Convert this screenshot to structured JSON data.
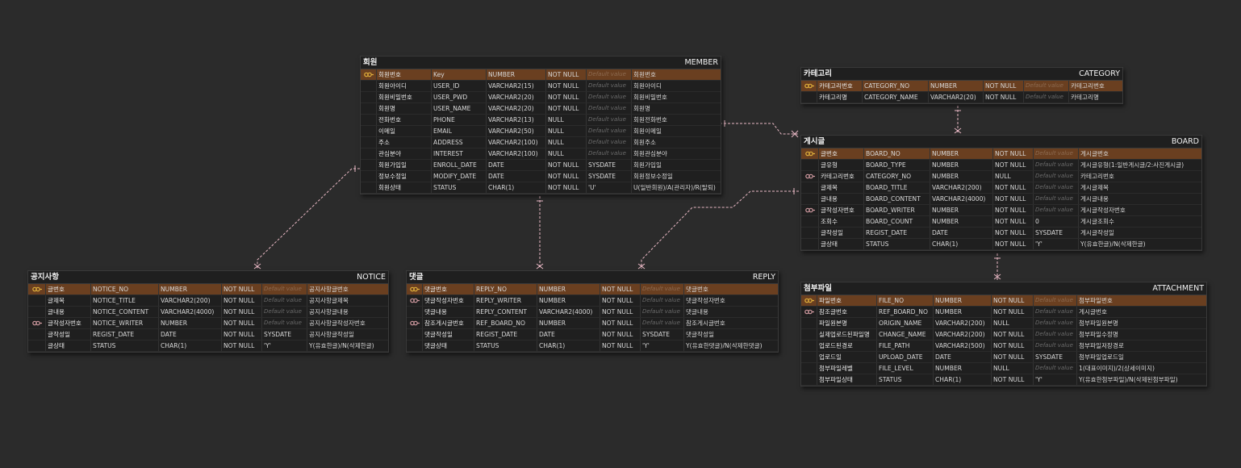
{
  "colors": {
    "background": "#2b2b2b",
    "entity_bg": "#1f1f1f",
    "pk_row": "#6a3f20",
    "pk_key": "#e0b03c",
    "fk_key": "#d09aa0",
    "link": "#e8b8c4"
  },
  "entities": [
    {
      "id": "member",
      "logical": "회원",
      "physical": "MEMBER",
      "columns": [
        {
          "key": "pk",
          "logical": "회원번호",
          "physical": "Key",
          "type": "NUMBER",
          "null": "NOT NULL",
          "default": "",
          "comment": "회원번호"
        },
        {
          "key": "",
          "logical": "회원아이디",
          "physical": "USER_ID",
          "type": "VARCHAR2(15)",
          "null": "NOT NULL",
          "default": "",
          "comment": "회원아이디"
        },
        {
          "key": "",
          "logical": "회원비밀번호",
          "physical": "USER_PWD",
          "type": "VARCHAR2(20)",
          "null": "NOT NULL",
          "default": "",
          "comment": "회원비밀번호"
        },
        {
          "key": "",
          "logical": "회원명",
          "physical": "USER_NAME",
          "type": "VARCHAR2(20)",
          "null": "NOT NULL",
          "default": "",
          "comment": "회원명"
        },
        {
          "key": "",
          "logical": "전화번호",
          "physical": "PHONE",
          "type": "VARCHAR2(13)",
          "null": "NULL",
          "default": "",
          "comment": "회원전화번호"
        },
        {
          "key": "",
          "logical": "이메일",
          "physical": "EMAIL",
          "type": "VARCHAR2(50)",
          "null": "NULL",
          "default": "",
          "comment": "회원이메일"
        },
        {
          "key": "",
          "logical": "주소",
          "physical": "ADDRESS",
          "type": "VARCHAR2(100)",
          "null": "NULL",
          "default": "",
          "comment": "회원주소"
        },
        {
          "key": "",
          "logical": "관심분야",
          "physical": "INTEREST",
          "type": "VARCHAR2(100)",
          "null": "NULL",
          "default": "",
          "comment": "회원관심분야"
        },
        {
          "key": "",
          "logical": "회원가입일",
          "physical": "ENROLL_DATE",
          "type": "DATE",
          "null": "NOT NULL",
          "default": "SYSDATE",
          "comment": "회원가입일"
        },
        {
          "key": "",
          "logical": "정보수정일",
          "physical": "MODIFY_DATE",
          "type": "DATE",
          "null": "NOT NULL",
          "default": "SYSDATE",
          "comment": "회원정보수정일"
        },
        {
          "key": "",
          "logical": "회원상태",
          "physical": "STATUS",
          "type": "CHAR(1)",
          "null": "NOT NULL",
          "default": "'U'",
          "comment": "U(일반회원)/A(관리자)/R(탈퇴)"
        }
      ]
    },
    {
      "id": "category",
      "logical": "카테고리",
      "physical": "CATEGORY",
      "columns": [
        {
          "key": "pk",
          "logical": "카테고리번호",
          "physical": "CATEGORY_NO",
          "type": "NUMBER",
          "null": "NOT NULL",
          "default": "",
          "comment": "카테고리번호"
        },
        {
          "key": "",
          "logical": "카테고리명",
          "physical": "CATEGORY_NAME",
          "type": "VARCHAR2(20)",
          "null": "NOT NULL",
          "default": "",
          "comment": "카테고리명"
        }
      ]
    },
    {
      "id": "board",
      "logical": "게시글",
      "physical": "BOARD",
      "columns": [
        {
          "key": "pk",
          "logical": "글번호",
          "physical": "BOARD_NO",
          "type": "NUMBER",
          "null": "NOT NULL",
          "default": "",
          "comment": "게시글번호"
        },
        {
          "key": "",
          "logical": "글유형",
          "physical": "BOARD_TYPE",
          "type": "NUMBER",
          "null": "NOT NULL",
          "default": "",
          "comment": "게시글유형(1:일반게시글/2:사진게시글)"
        },
        {
          "key": "fk",
          "logical": "카테고리번호",
          "physical": "CATEGORY_NO",
          "type": "NUMBER",
          "null": "NULL",
          "default": "",
          "comment": "카테고리번호"
        },
        {
          "key": "",
          "logical": "글제목",
          "physical": "BOARD_TITLE",
          "type": "VARCHAR2(200)",
          "null": "NOT NULL",
          "default": "",
          "comment": "게시글제목"
        },
        {
          "key": "",
          "logical": "글내용",
          "physical": "BOARD_CONTENT",
          "type": "VARCHAR2(4000)",
          "null": "NOT NULL",
          "default": "",
          "comment": "게시글내용"
        },
        {
          "key": "fk",
          "logical": "글작성자번호",
          "physical": "BOARD_WRITER",
          "type": "NUMBER",
          "null": "NOT NULL",
          "default": "",
          "comment": "게시글작성자번호"
        },
        {
          "key": "",
          "logical": "조회수",
          "physical": "BOARD_COUNT",
          "type": "NUMBER",
          "null": "NOT NULL",
          "default": "0",
          "comment": "게시글조회수"
        },
        {
          "key": "",
          "logical": "글작성일",
          "physical": "REGIST_DATE",
          "type": "DATE",
          "null": "NOT NULL",
          "default": "SYSDATE",
          "comment": "게시글작성일"
        },
        {
          "key": "",
          "logical": "글상태",
          "physical": "STATUS",
          "type": "CHAR(1)",
          "null": "NOT NULL",
          "default": "'Y'",
          "comment": "Y(유효한글)/N(삭제한글)"
        }
      ]
    },
    {
      "id": "notice",
      "logical": "공지사항",
      "physical": "NOTICE",
      "columns": [
        {
          "key": "pk",
          "logical": "글번호",
          "physical": "NOTICE_NO",
          "type": "NUMBER",
          "null": "NOT NULL",
          "default": "",
          "comment": "공지사항글번호"
        },
        {
          "key": "",
          "logical": "글제목",
          "physical": "NOTICE_TITLE",
          "type": "VARCHAR2(200)",
          "null": "NOT NULL",
          "default": "",
          "comment": "공지사항글제목"
        },
        {
          "key": "",
          "logical": "글내용",
          "physical": "NOTICE_CONTENT",
          "type": "VARCHAR2(4000)",
          "null": "NOT NULL",
          "default": "",
          "comment": "공지사항글내용"
        },
        {
          "key": "fk",
          "logical": "글작성자번호",
          "physical": "NOTICE_WRITER",
          "type": "NUMBER",
          "null": "NOT NULL",
          "default": "",
          "comment": "공지사항글작성자번호"
        },
        {
          "key": "",
          "logical": "글작성일",
          "physical": "REGIST_DATE",
          "type": "DATE",
          "null": "NOT NULL",
          "default": "SYSDATE",
          "comment": "공지사항글작성일"
        },
        {
          "key": "",
          "logical": "글상태",
          "physical": "STATUS",
          "type": "CHAR(1)",
          "null": "NOT NULL",
          "default": "'Y'",
          "comment": "Y(유효한글)/N(삭제한글)"
        }
      ]
    },
    {
      "id": "reply",
      "logical": "댓글",
      "physical": "REPLY",
      "columns": [
        {
          "key": "pk",
          "logical": "댓글번호",
          "physical": "REPLY_NO",
          "type": "NUMBER",
          "null": "NOT NULL",
          "default": "",
          "comment": "댓글번호"
        },
        {
          "key": "fk",
          "logical": "댓글작성자번호",
          "physical": "REPLY_WRITER",
          "type": "NUMBER",
          "null": "NOT NULL",
          "default": "",
          "comment": "댓글작성자번호"
        },
        {
          "key": "",
          "logical": "댓글내용",
          "physical": "REPLY_CONTENT",
          "type": "VARCHAR2(4000)",
          "null": "NOT NULL",
          "default": "",
          "comment": "댓글내용"
        },
        {
          "key": "fk",
          "logical": "참조게시글번호",
          "physical": "REF_BOARD_NO",
          "type": "NUMBER",
          "null": "NOT NULL",
          "default": "",
          "comment": "참조게시글번호"
        },
        {
          "key": "",
          "logical": "댓글작성일",
          "physical": "REGIST_DATE",
          "type": "DATE",
          "null": "NOT NULL",
          "default": "SYSDATE",
          "comment": "댓글작성일"
        },
        {
          "key": "",
          "logical": "댓글상태",
          "physical": "STATUS",
          "type": "CHAR(1)",
          "null": "NOT NULL",
          "default": "'Y'",
          "comment": "Y(유효한댓글)/N(삭제한댓글)"
        }
      ]
    },
    {
      "id": "attachment",
      "logical": "첨부파일",
      "physical": "ATTACHMENT",
      "columns": [
        {
          "key": "pk",
          "logical": "파일번호",
          "physical": "FILE_NO",
          "type": "NUMBER",
          "null": "NOT NULL",
          "default": "",
          "comment": "첨부파일번호"
        },
        {
          "key": "fk",
          "logical": "참조글번호",
          "physical": "REF_BOARD_NO",
          "type": "NUMBER",
          "null": "NOT NULL",
          "default": "",
          "comment": "게시글번호"
        },
        {
          "key": "",
          "logical": "파일원본명",
          "physical": "ORIGIN_NAME",
          "type": "VARCHAR2(200)",
          "null": "NULL",
          "default": "",
          "comment": "첨부파일원본명"
        },
        {
          "key": "",
          "logical": "실제업로드된파일명",
          "physical": "CHANGE_NAME",
          "type": "VARCHAR2(200)",
          "null": "NOT NULL",
          "default": "",
          "comment": "첨부파일수정명"
        },
        {
          "key": "",
          "logical": "업로드된경로",
          "physical": "FILE_PATH",
          "type": "VARCHAR2(500)",
          "null": "NOT NULL",
          "default": "",
          "comment": "첨부파일저장경로"
        },
        {
          "key": "",
          "logical": "업로드일",
          "physical": "UPLOAD_DATE",
          "type": "DATE",
          "null": "NOT NULL",
          "default": "SYSDATE",
          "comment": "첨부파일업로드일"
        },
        {
          "key": "",
          "logical": "첨부파일레벨",
          "physical": "FILE_LEVEL",
          "type": "NUMBER",
          "null": "NULL",
          "default": "",
          "comment": "1(대표이미지)/2(상세이미지)"
        },
        {
          "key": "",
          "logical": "첨부파일상태",
          "physical": "STATUS",
          "type": "CHAR(1)",
          "null": "NOT NULL",
          "default": "'Y'",
          "comment": "Y(유효한첨부파일)/N(삭제된첨부파일)"
        }
      ]
    }
  ],
  "default_placeholder": "Default value"
}
